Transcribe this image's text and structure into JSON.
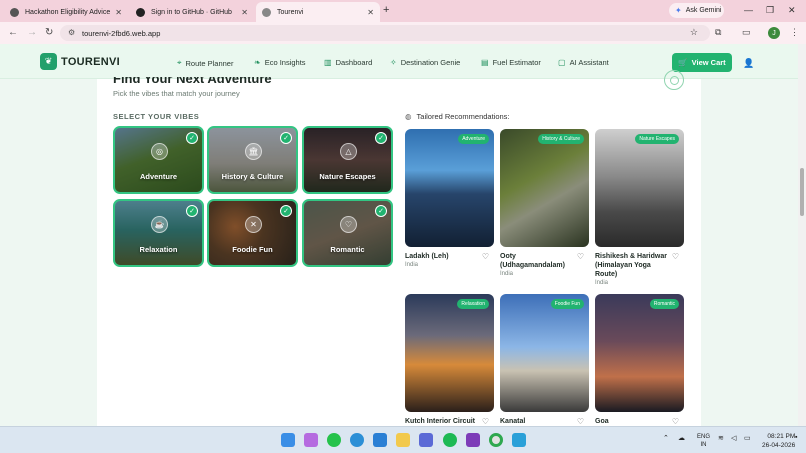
{
  "browser": {
    "tabs": [
      {
        "title": "Hackathon Eligibility Advice"
      },
      {
        "title": "Sign in to GitHub · GitHub"
      },
      {
        "title": "Tourenvi"
      }
    ],
    "gemini_label": "Ask Gemini",
    "url": "tourenvi-2fbd6.web.app",
    "profile_initial": "J"
  },
  "app": {
    "brand": "TOURENVI",
    "nav": [
      {
        "label": "Route Planner",
        "icon": "map-pin-icon"
      },
      {
        "label": "Eco Insights",
        "icon": "leaf-icon"
      },
      {
        "label": "Dashboard",
        "icon": "bar-chart-icon"
      },
      {
        "label": "Destination Genie",
        "icon": "sparkle-icon"
      },
      {
        "label": "Fuel Estimator",
        "icon": "fuel-icon"
      },
      {
        "label": "AI Assistant",
        "icon": "chat-icon"
      }
    ],
    "cart_label": "View Cart"
  },
  "main": {
    "title": "Find Your Next Adventure",
    "subtitle": "Pick the vibes that match your journey",
    "vibes_label": "SELECT YOUR VIBES",
    "vibes": [
      {
        "label": "Adventure",
        "icon": "compass-icon",
        "selected": true
      },
      {
        "label": "History & Culture",
        "icon": "landmark-icon",
        "selected": true
      },
      {
        "label": "Nature Escapes",
        "icon": "mountain-icon",
        "selected": true
      },
      {
        "label": "Relaxation",
        "icon": "coffee-icon",
        "selected": true
      },
      {
        "label": "Foodie Fun",
        "icon": "utensils-icon",
        "selected": true
      },
      {
        "label": "Romantic",
        "icon": "heart-icon",
        "selected": true
      }
    ],
    "recs_label": "Tailored Recommendations:",
    "recommendations": [
      {
        "name": "Ladakh (Leh)",
        "country": "India",
        "badge": "Adventure"
      },
      {
        "name": "Ooty (Udhagamandalam)",
        "country": "India",
        "badge": "History & Culture"
      },
      {
        "name": "Rishikesh & Haridwar (Himalayan Yoga Route)",
        "country": "India",
        "badge": "Nature Escapes"
      },
      {
        "name": "Kutch Interior Circuit",
        "country": "",
        "badge": "Relaxation"
      },
      {
        "name": "Kanatal",
        "country": "",
        "badge": "Foodie Fun"
      },
      {
        "name": "Goa",
        "country": "",
        "badge": "Romantic"
      }
    ]
  },
  "taskbar": {
    "lang": "ENG",
    "region": "IN",
    "time": "08:21 PM",
    "date": "26-04-2026"
  }
}
